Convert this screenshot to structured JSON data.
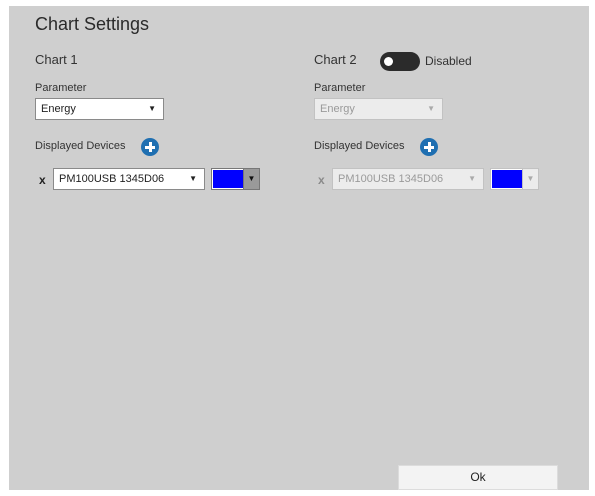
{
  "dialog": {
    "title": "Chart Settings",
    "ok_label": "Ok"
  },
  "chart1": {
    "label": "Chart 1",
    "parameter_label": "Parameter",
    "parameter_value": "Energy",
    "devices_label": "Displayed Devices",
    "devices": [
      {
        "remove": "x",
        "name": "PM100USB 1345D06",
        "color": "#0000ff"
      }
    ]
  },
  "chart2": {
    "label": "Chart 2",
    "toggle_state": "Disabled",
    "enabled": false,
    "parameter_label": "Parameter",
    "parameter_value": "Energy",
    "devices_label": "Displayed Devices",
    "devices": [
      {
        "remove": "x",
        "name": "PM100USB 1345D06",
        "color": "#0000ff"
      }
    ]
  },
  "icons": {
    "add": "plus-circle-icon",
    "dropdown": "chevron-down-icon"
  },
  "colors": {
    "panel_bg": "#cfcfcf",
    "accent": "#1f6fb1",
    "device_color": "#0000ff"
  }
}
